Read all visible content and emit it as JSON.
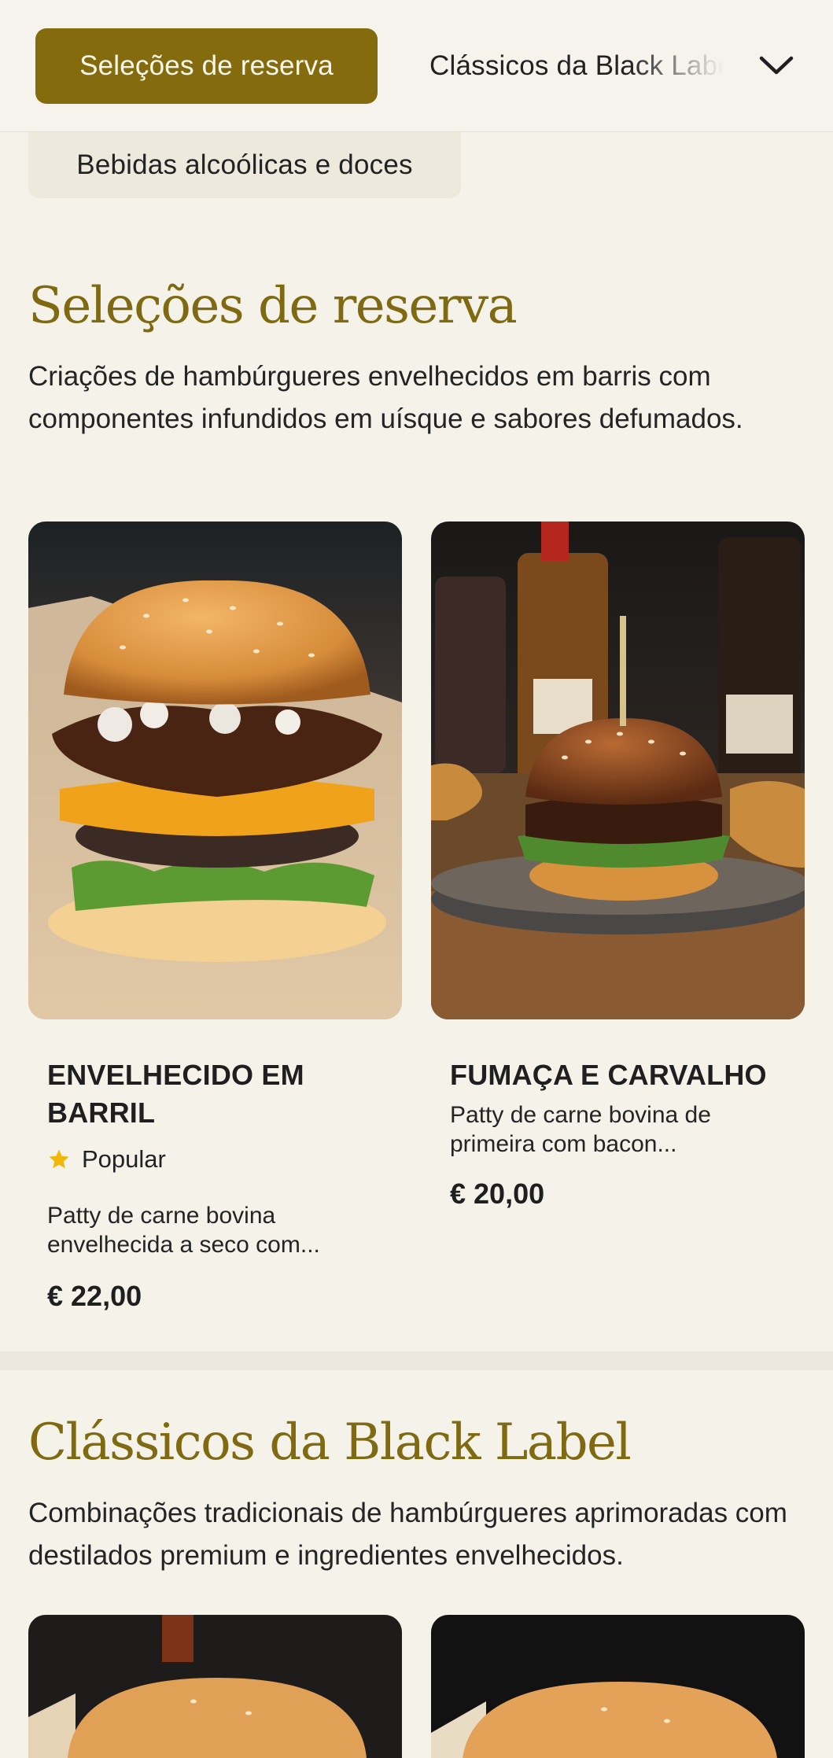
{
  "nav": {
    "categories": [
      {
        "label": "Seleções de reserva",
        "active": true
      },
      {
        "label": "Clássicos da Black Label",
        "active": false
      },
      {
        "label": "Bebidas alcoólicas e doces",
        "active": false
      }
    ],
    "expand_icon": "chevron-down-icon"
  },
  "sections": [
    {
      "title": "Seleções de reserva",
      "description": "Criações de hambúrgueres envelhecidos em barris com componentes infundidos em uísque e sabores defumados.",
      "items": [
        {
          "name": "ENVELHECIDO EM BARRIL",
          "badge": "Popular",
          "badge_icon": "star-icon",
          "description": "Patty de carne bovina envelhecida a seco com...",
          "price": "€ 22,00"
        },
        {
          "name": "FUMAÇA E CARVALHO",
          "description": "Patty de carne bovina de primeira com bacon...",
          "price": "€ 20,00"
        }
      ]
    },
    {
      "title": "Clássicos da Black Label",
      "description": "Combinações tradicionais de hambúrgueres aprimoradas com destilados premium e ingredientes envelhecidos."
    }
  ],
  "colors": {
    "accent": "#846b0e",
    "heading": "#7f6a12",
    "background": "#f5f2ea",
    "star": "#f2b705"
  }
}
